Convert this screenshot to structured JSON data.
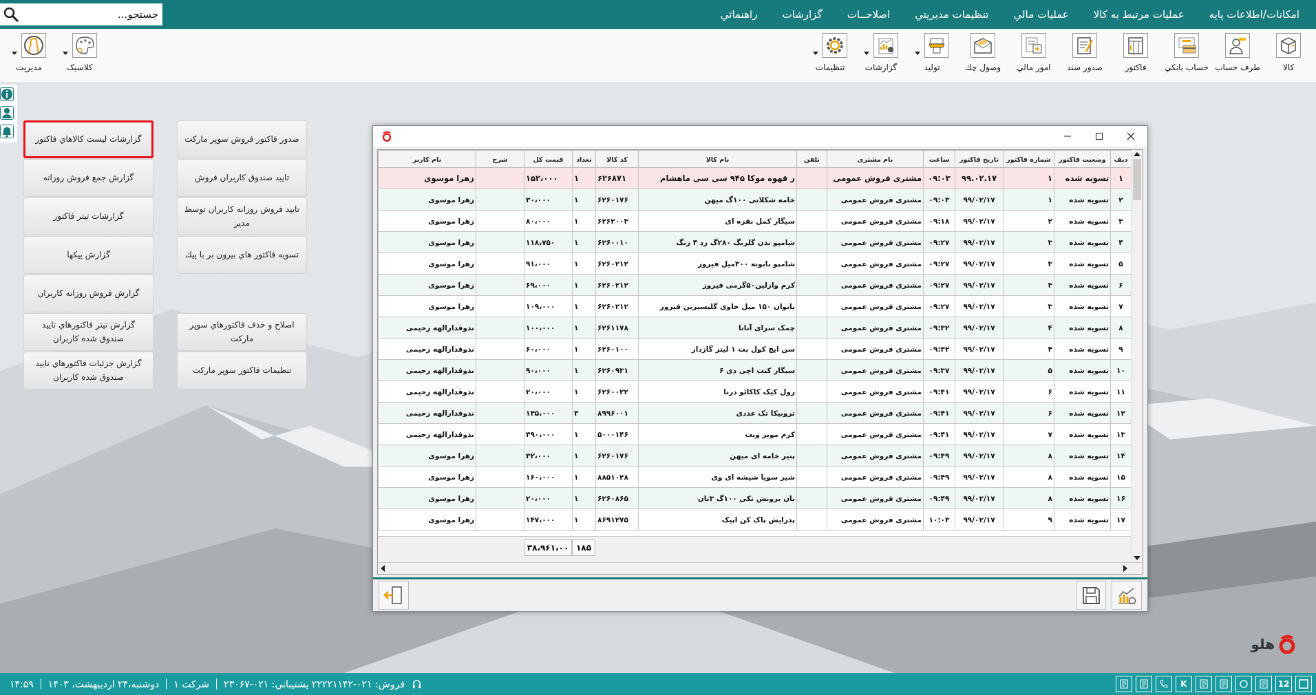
{
  "menu_bar": {
    "search": {
      "placeholder": "جستجو..."
    },
    "items": [
      "امکانات/اطلاعات پایه",
      "عملیات مرتبط به کالا",
      "عملیات مالي",
      "تنظیمات مدیریتي",
      "اصلاحــات",
      "گزارشات",
      "راهنمائي"
    ]
  },
  "toolbar": {
    "main": [
      {
        "label": "کالا",
        "has_menu": false
      },
      {
        "label": "طرف حساب",
        "has_menu": false
      },
      {
        "label": "حساب بانکي",
        "has_menu": false
      },
      {
        "label": "فاکتور",
        "has_menu": false
      },
      {
        "label": "صدور سند",
        "has_menu": false
      },
      {
        "label": "امور مالي",
        "has_menu": false
      },
      {
        "label": "وصول چك",
        "has_menu": false
      },
      {
        "label": "تولید",
        "has_menu": true
      },
      {
        "label": "گزارشات",
        "has_menu": true
      },
      {
        "label": "تنظیمات",
        "has_menu": true
      }
    ],
    "extra": [
      {
        "label": "کلاسیک",
        "has_menu": true
      },
      {
        "label": "مدیریت",
        "has_menu": true
      }
    ]
  },
  "launch_buttons": {
    "right_column_top": [
      {
        "label": "صدور فاکتور فروش سوپر مارکت",
        "selected": false
      },
      {
        "label": "تایید صندوق کاربران فروش",
        "selected": false
      },
      {
        "label": "تایید فروش روزانه کاربران توسط مدیر",
        "selected": false
      },
      {
        "label": "تسویه فاکتور هاي بیرون بر با پیك",
        "selected": false
      }
    ],
    "right_column_bottom": [
      {
        "label": "اصلاح و حذف فاکتورهاي سوپر مارکت",
        "selected": false
      },
      {
        "label": "تنظیمات فاکتور سوپر مارکت",
        "selected": false
      }
    ],
    "left_column": [
      {
        "label": "گزارشات لیست کالاهاي فاکتور",
        "selected": true
      },
      {
        "label": "گزارش جمع فروش روزانه",
        "selected": false
      },
      {
        "label": "گزارشات تیتر فاکتور",
        "selected": false
      },
      {
        "label": "گزارش پیکها",
        "selected": false
      },
      {
        "label": "گزارش فروش روزانه کاربران",
        "selected": false
      },
      {
        "label": "گزارش تیتر فاکتورهاي تایید صندوق شده کاربران",
        "selected": false
      },
      {
        "label": "گزارش جزئیات فاکتورهاي تایید صندوق شده کاربران",
        "selected": false
      }
    ]
  },
  "report_window": {
    "columns": [
      "دیف",
      "وضعیت فاکتور",
      "شماره فاکتور",
      "تاریخ فاکتور",
      "ساعت",
      "نام مشتری",
      "تلفن",
      "نام کالا",
      "کد کالا",
      "تعداد",
      "قیمت کل",
      "شرح",
      "نام کاربر"
    ],
    "rows": [
      {
        "selected": true,
        "cells": [
          "۱",
          "تسویه شده",
          "۱",
          "۹۹.۰۲.۱۷",
          "۰۹:۰۳",
          "مشتری فروش عمومی",
          "",
          "ر قهوه موکا ۹۴۵ سی سی ماهشام",
          "۶۲۶۸۷۱",
          "۱",
          "۱۵۲،۰۰۰",
          "",
          "زهرا موسوی"
        ]
      },
      {
        "selected": false,
        "cells": [
          "۲",
          "تسویه شده",
          "۱",
          "۹۹/۰۲/۱۷",
          "۰۹:۰۳",
          "مشتری فروش عمومی",
          "",
          "خامه شکلاتی ۱۰۰گ میهن",
          "۶۲۶۰۱۷۶",
          "۱",
          "۳۰،۰۰۰",
          "",
          "زهرا موسوی"
        ]
      },
      {
        "selected": false,
        "cells": [
          "۳",
          "تسویه شده",
          "۲",
          "۹۹/۰۲/۱۷",
          "۰۹:۱۸",
          "مشتری فروش عمومی",
          "",
          "سیگار کمل نقره ای",
          "۶۲۶۲۰۰۳",
          "۱",
          "۸۰،۰۰۰",
          "",
          "زهرا موسوی"
        ]
      },
      {
        "selected": false,
        "cells": [
          "۴",
          "تسویه شده",
          "۳",
          "۹۹/۰۲/۱۷",
          "۰۹:۲۷",
          "مشتری فروش عمومی",
          "",
          "شامپو بدن گلرنگ ۲۸۰گ رد ۴ رنگ",
          "۶۲۶۰۰۱۰",
          "۱",
          "۱۱۸،۷۵۰",
          "",
          "زهرا موسوی"
        ]
      },
      {
        "selected": false,
        "cells": [
          "۵",
          "تسویه شده",
          "۳",
          "۹۹/۰۲/۱۷",
          "۰۹:۲۷",
          "مشتری فروش عمومی",
          "",
          "شامپو بابونه ۳۰۰میل فیروز",
          "۶۲۶۰۲۱۲",
          "۱",
          "۹۱،۰۰۰",
          "",
          "زهرا موسوی"
        ]
      },
      {
        "selected": false,
        "cells": [
          "۶",
          "تسویه شده",
          "۳",
          "۹۹/۰۲/۱۷",
          "۰۹:۲۷",
          "مشتری فروش عمومی",
          "",
          "کرم وازلین۵۰گرمی فیروز",
          "۶۲۶۰۲۱۲",
          "۱",
          "۶۹،۰۰۰",
          "",
          "زهرا موسوی"
        ]
      },
      {
        "selected": false,
        "cells": [
          "۷",
          "تسویه شده",
          "۳",
          "۹۹/۰۲/۱۷",
          "۰۹:۲۷",
          "مشتری فروش عمومی",
          "",
          "بانوان ۱۵۰ میل حاوی گلیسیرین فیروز",
          "۶۲۶۰۲۱۲",
          "۱",
          "۱۰۹،۰۰۰",
          "",
          "زهرا موسوی"
        ]
      },
      {
        "selected": false,
        "cells": [
          "۸",
          "تسویه شده",
          "۴",
          "۹۹/۰۲/۱۷",
          "۰۹:۳۲",
          "مشتری فروش عمومی",
          "",
          "چمک سرای آناتا",
          "۶۲۶۱۱۷۸",
          "۱",
          "۱۰۰،۰۰۰",
          "",
          "ندوقدارالهه رحیمی"
        ]
      },
      {
        "selected": false,
        "cells": [
          "۹",
          "تسویه شده",
          "۴",
          "۹۹/۰۲/۱۷",
          "۰۹:۳۲",
          "مشتری فروش عمومی",
          "",
          "سن ایچ کول پت ۱ لیتر گازدار",
          "۶۲۶۰۱۰۰",
          "۱",
          "۶۰،۰۰۰",
          "",
          "ندوقدارالهه رحیمی"
        ]
      },
      {
        "selected": false,
        "cells": [
          "۱۰",
          "تسویه شده",
          "۵",
          "۹۹/۰۲/۱۷",
          "۰۹:۳۷",
          "مشتری فروش عمومی",
          "",
          "سیگار کنت اچی دی ۶",
          "۶۲۶۰۹۳۱",
          "۱",
          "۹۰،۰۰۰",
          "",
          "ندوقدارالهه رحیمی"
        ]
      },
      {
        "selected": false,
        "cells": [
          "۱۱",
          "تسویه شده",
          "۶",
          "۹۹/۰۲/۱۷",
          "۰۹:۴۱",
          "مشتری فروش عمومی",
          "",
          "رول کیک کاکائو درنا",
          "۶۲۶۰۰۲۲",
          "۱",
          "۲۰،۰۰۰",
          "",
          "ندوقدارالهه رحیمی"
        ]
      },
      {
        "selected": false,
        "cells": [
          "۱۲",
          "تسویه شده",
          "۶",
          "۹۹/۰۲/۱۷",
          "۰۹:۴۱",
          "مشتری فروش عمومی",
          "",
          "تروبیکا تک عددی",
          "۸۹۹۶۰۰۱",
          "۳",
          "۱۳۵،۰۰۰",
          "",
          "ندوقدارالهه رحیمی"
        ]
      },
      {
        "selected": false,
        "cells": [
          "۱۳",
          "تسویه شده",
          "۷",
          "۹۹/۰۲/۱۷",
          "۰۹:۴۱",
          "مشتری فروش عمومی",
          "",
          "کرم موبر ویت",
          "۵۰۰۰۱۴۶",
          "۱",
          "۴۹۰،۰۰۰",
          "",
          "ندوقدارالهه رحیمی"
        ]
      },
      {
        "selected": false,
        "cells": [
          "۱۴",
          "تسویه شده",
          "۸",
          "۹۹/۰۲/۱۷",
          "۰۹:۴۹",
          "مشتری فروش عمومی",
          "",
          "پنیر خامه ای میهن",
          "۶۲۶۰۱۷۶",
          "۱",
          "۳۲،۰۰۰",
          "",
          "زهرا موسوی"
        ]
      },
      {
        "selected": false,
        "cells": [
          "۱۵",
          "تسویه شده",
          "۸",
          "۹۹/۰۲/۱۷",
          "۰۹:۴۹",
          "مشتری فروش عمومی",
          "",
          "شیر سویا شیشه ای وی",
          "۸۸۵۱۰۲۸",
          "۱",
          "۱۶۰،۰۰۰",
          "",
          "زهرا موسوی"
        ]
      },
      {
        "selected": false,
        "cells": [
          "۱۶",
          "تسویه شده",
          "۸",
          "۹۹/۰۲/۱۷",
          "۰۹:۴۹",
          "مشتری فروش عمومی",
          "",
          "نان برونش تکی ۱۰۰گ ۳تان",
          "۶۲۶۰۸۶۵",
          "۱",
          "۲۰،۰۰۰",
          "",
          "زهرا موسوی"
        ]
      },
      {
        "selected": false,
        "cells": [
          "۱۷",
          "تسویه شده",
          "۹",
          "۹۹/۰۲/۱۷",
          "۱۰:۰۳",
          "مشتری فروش عمومی",
          "",
          "پدرایش پاک کن اپیک",
          "۸۶۹۱۲۷۵",
          "۱",
          "۱۴۷،۰۰۰",
          "",
          "زهرا موسوی"
        ]
      }
    ],
    "totals": {
      "quantity": "۱۸۵",
      "total_price": "۳۸،۹۶۱،۰۰"
    }
  },
  "logo_text": "هلو",
  "status_bar": {
    "calendar_day": "12",
    "shortcut_key": "K",
    "segments": [
      "فروش: ۰۲۱-۲۲۲۲۱۱۴۲ پشتیباني: ۰۲۱-۲۳۰۶۷",
      "شرکت ۱",
      "دوشنبه،۲۴ اردیبهشت، ۱۴۰۳",
      "۱۴:۵۹"
    ]
  }
}
